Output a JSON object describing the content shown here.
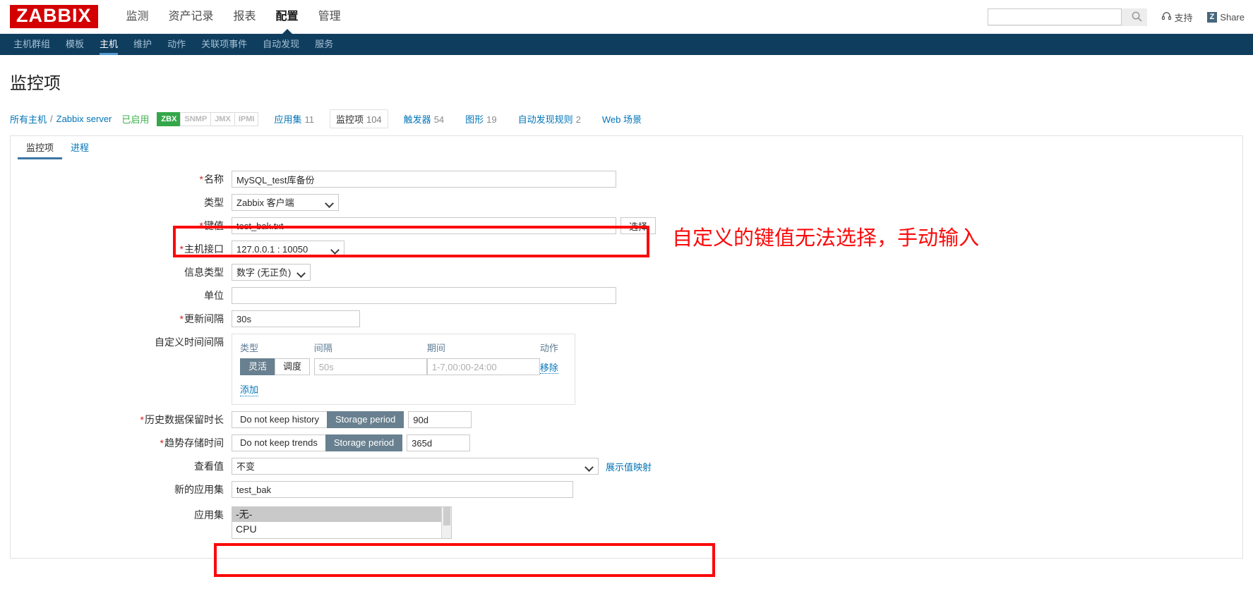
{
  "header": {
    "logo": "ZABBIX",
    "nav": [
      {
        "label": "监测",
        "active": false
      },
      {
        "label": "资产记录",
        "active": false
      },
      {
        "label": "报表",
        "active": false
      },
      {
        "label": "配置",
        "active": true
      },
      {
        "label": "管理",
        "active": false
      }
    ],
    "search_placeholder": "",
    "search_value": "",
    "support_label": "支持",
    "share_label": "Share",
    "share_badge": "Z"
  },
  "subnav": [
    {
      "label": "主机群组",
      "active": false
    },
    {
      "label": "模板",
      "active": false
    },
    {
      "label": "主机",
      "active": true
    },
    {
      "label": "维护",
      "active": false
    },
    {
      "label": "动作",
      "active": false
    },
    {
      "label": "关联项事件",
      "active": false
    },
    {
      "label": "自动发现",
      "active": false
    },
    {
      "label": "服务",
      "active": false
    }
  ],
  "page": {
    "title": "监控项"
  },
  "breadcrumb": {
    "all_hosts": "所有主机",
    "separator": "/",
    "host": "Zabbix server",
    "enabled": "已启用",
    "protocols": [
      {
        "label": "ZBX",
        "on": true
      },
      {
        "label": "SNMP",
        "on": false
      },
      {
        "label": "JMX",
        "on": false
      },
      {
        "label": "IPMI",
        "on": false
      }
    ],
    "tabs": [
      {
        "label": "应用集",
        "count": "11",
        "selected": false
      },
      {
        "label": "监控项",
        "count": "104",
        "selected": true
      },
      {
        "label": "触发器",
        "count": "54",
        "selected": false
      },
      {
        "label": "图形",
        "count": "19",
        "selected": false
      },
      {
        "label": "自动发现规则",
        "count": "2",
        "selected": false
      },
      {
        "label": "Web 场景",
        "count": "",
        "selected": false
      }
    ]
  },
  "tabs": [
    {
      "label": "监控项",
      "active": true
    },
    {
      "label": "进程",
      "active": false
    }
  ],
  "form": {
    "name": {
      "label": "名称",
      "value": "MySQL_test库备份",
      "required": true
    },
    "type": {
      "label": "类型",
      "value": "Zabbix 客户端",
      "required": false
    },
    "key": {
      "label": "键值",
      "value": "test_bak.txt",
      "required": true,
      "button": "选择"
    },
    "host_interface": {
      "label": "主机接口",
      "value": "127.0.0.1 : 10050",
      "required": true
    },
    "value_type": {
      "label": "信息类型",
      "value": "数字 (无正负)",
      "required": false
    },
    "units": {
      "label": "单位",
      "value": "",
      "required": false
    },
    "update_interval": {
      "label": "更新间隔",
      "value": "30s",
      "required": true
    },
    "custom_intervals": {
      "label": "自定义时间间隔",
      "columns": {
        "type": "类型",
        "interval": "间隔",
        "period": "期间",
        "action": "动作"
      },
      "row": {
        "flexible": "灵活",
        "scheduling": "调度",
        "active_mode": "灵活",
        "interval_placeholder": "50s",
        "interval_value": "",
        "period_placeholder": "1-7,00:00-24:00",
        "period_value": "",
        "remove": "移除"
      },
      "add": "添加"
    },
    "history": {
      "label": "历史数据保留时长",
      "required": true,
      "option_off": "Do not keep history",
      "option_on": "Storage period",
      "active": "Storage period",
      "value": "90d"
    },
    "trends": {
      "label": "趋势存储时间",
      "required": true,
      "option_off": "Do not keep trends",
      "option_on": "Storage period",
      "active": "Storage period",
      "value": "365d"
    },
    "show_value": {
      "label": "查看值",
      "value": "不变",
      "map_link": "展示值映射"
    },
    "new_application": {
      "label": "新的应用集",
      "value": "test_bak"
    },
    "applications": {
      "label": "应用集",
      "options": [
        {
          "label": "-无-",
          "selected": true
        },
        {
          "label": "CPU",
          "selected": false
        }
      ]
    }
  },
  "annotation": {
    "key_note": "自定义的键值无法选择，手动输入"
  },
  "colors": {
    "brand_red": "#d40000",
    "nav_dark": "#0f3d5e",
    "link_blue": "#0275b8",
    "green_badge": "#34a74a",
    "enabled_green": "#3db04c",
    "segment_active": "#68808f",
    "annotation_red": "#fb0a0a",
    "focus_green": "#3a9a8f"
  }
}
